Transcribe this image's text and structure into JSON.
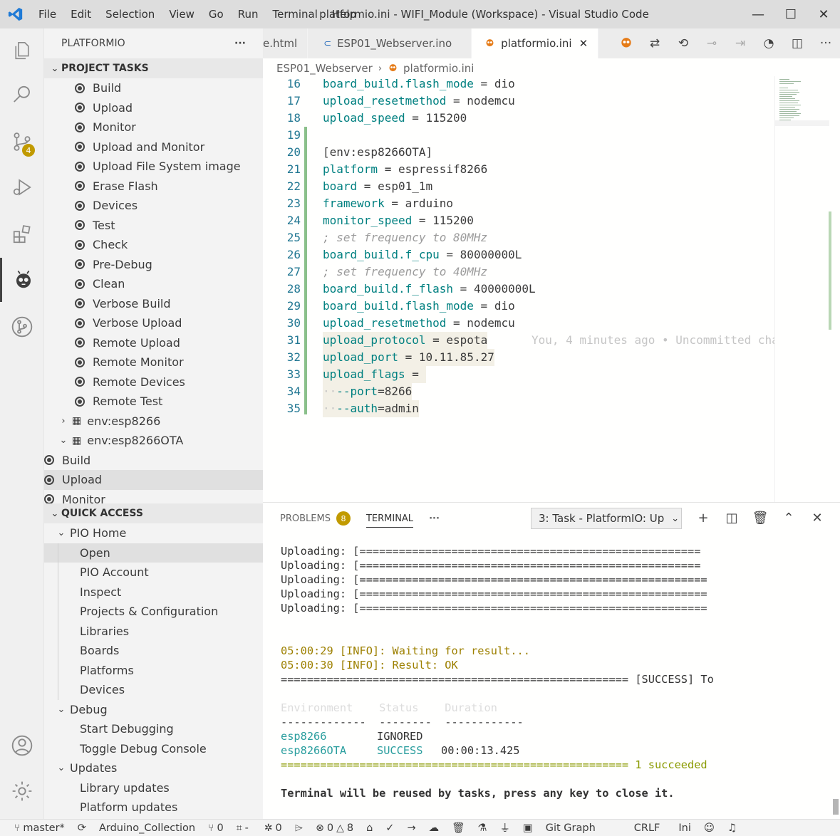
{
  "window": {
    "title": "platformio.ini - WIFI_Module (Workspace) - Visual Studio Code",
    "menu": [
      "File",
      "Edit",
      "Selection",
      "View",
      "Go",
      "Run",
      "Terminal",
      "Help"
    ],
    "controls": [
      "—",
      "☐",
      "✕"
    ]
  },
  "activity": {
    "scm_badge": "4"
  },
  "sidebar": {
    "title": "PLATFORMIO",
    "more": "···",
    "project_tasks": {
      "header": "PROJECT TASKS",
      "tasks": [
        "Build",
        "Upload",
        "Monitor",
        "Upload and Monitor",
        "Upload File System image",
        "Erase Flash",
        "Devices",
        "Test",
        "Check",
        "Pre-Debug",
        "Clean",
        "Verbose Build",
        "Verbose Upload",
        "Remote Upload",
        "Remote Monitor",
        "Remote Devices",
        "Remote Test"
      ],
      "env1": "env:esp8266",
      "env2": "env:esp8266OTA",
      "env2_tasks": [
        "Build",
        "Upload",
        "Monitor"
      ]
    },
    "quick_access": {
      "header": "QUICK ACCESS",
      "pio_home": "PIO Home",
      "pio_home_items": [
        "Open",
        "PIO Account",
        "Inspect",
        "Projects & Configuration",
        "Libraries",
        "Boards",
        "Platforms",
        "Devices"
      ],
      "debug": "Debug",
      "debug_items": [
        "Start Debugging",
        "Toggle Debug Console"
      ],
      "updates": "Updates",
      "updates_items": [
        "Library updates",
        "Platform updates"
      ]
    }
  },
  "tabs": [
    {
      "label": "e.html"
    },
    {
      "label": "ESP01_Webserver.ino"
    },
    {
      "label": "platformio.ini",
      "close": "✕"
    }
  ],
  "breadcrumb": {
    "folder": "ESP01_Webserver",
    "sep": "›",
    "file": "platformio.ini"
  },
  "code": [
    {
      "n": "16",
      "key": "board_build.flash_mode",
      "op": " = ",
      "val": "dio"
    },
    {
      "n": "17",
      "key": "upload_resetmethod",
      "op": " = ",
      "val": "nodemcu"
    },
    {
      "n": "18",
      "key": "upload_speed",
      "op": " = ",
      "val": "115200"
    },
    {
      "n": "19"
    },
    {
      "n": "20",
      "plain": "[env:esp8266OTA]"
    },
    {
      "n": "21",
      "key": "platform",
      "op": " = ",
      "val": "espressif8266"
    },
    {
      "n": "22",
      "key": "board",
      "op": " = ",
      "val": "esp01_1m"
    },
    {
      "n": "23",
      "key": "framework",
      "op": " = ",
      "val": "arduino"
    },
    {
      "n": "24",
      "key": "monitor_speed",
      "op": " = ",
      "val": "115200"
    },
    {
      "n": "25",
      "comment": "; set frequency to 80MHz"
    },
    {
      "n": "26",
      "key": "board_build.f_cpu",
      "op": " = ",
      "val": "80000000L"
    },
    {
      "n": "27",
      "comment": "; set frequency to 40MHz"
    },
    {
      "n": "28",
      "key": "board_build.f_flash",
      "op": " = ",
      "val": "40000000L"
    },
    {
      "n": "29",
      "key": "board_build.flash_mode",
      "op": " = ",
      "val": "dio"
    },
    {
      "n": "30",
      "key": "upload_resetmethod",
      "op": " = ",
      "val": "nodemcu"
    },
    {
      "n": "31",
      "key": "upload_protocol",
      "op": " = ",
      "val": "espota",
      "blame": "You, 4 minutes ago • Uncommitted cha"
    },
    {
      "n": "32",
      "key": "upload_port",
      "op": " = ",
      "val": "10.11.85.27"
    },
    {
      "n": "33",
      "key": "upload_flags",
      "op": " = ",
      "val": ""
    },
    {
      "n": "34",
      "indent": "··",
      "key": "--port",
      "op": "=",
      "val": "8266"
    },
    {
      "n": "35",
      "indent": "··",
      "key": "--auth",
      "op": "=",
      "val": "admin"
    }
  ],
  "panel": {
    "problems": "PROBLEMS",
    "problems_count": "8",
    "terminal": "TERMINAL",
    "more": "···",
    "selector": "3: Task - PlatformIO: Up",
    "lines": {
      "u1": "Uploading: [====================================================",
      "u2": "Uploading: [====================================================",
      "u3": "Uploading: [=====================================================",
      "u4": "Uploading: [=====================================================",
      "u5": "Uploading: [=====================================================",
      "i1": "05:00:29 [INFO]: Waiting for result...",
      "i2": "05:00:30 [INFO]: Result: OK",
      "s1a": "=====================================================",
      "s1b": " [SUCCESS] To",
      "hdr": "Environment    Status    Duration",
      "dash": "-------------  --------  ------------",
      "r1env": "esp8266",
      "r1st": "IGNORED",
      "r2env": "esp8266OTA",
      "r2st": "SUCCESS",
      "r2dur": "00:00:13.425",
      "s2": "===================================================== 1 succeeded",
      "final": "Terminal will be reused by tasks, press any key to close it."
    }
  },
  "status": {
    "branch": "master*",
    "project": "Arduino_Collection",
    "pr": "0",
    "env": "-",
    "debug": "0",
    "errors": "0",
    "warnings": "8",
    "git_graph": "Git Graph",
    "eol": "CRLF",
    "lang": "Ini"
  },
  "colors": {
    "accent_badge": "#c19a00",
    "key": "#2e8b57",
    "value": "#0451a5",
    "terminal_yellow": "#9d8000",
    "terminal_green": "#2a9e9e"
  }
}
